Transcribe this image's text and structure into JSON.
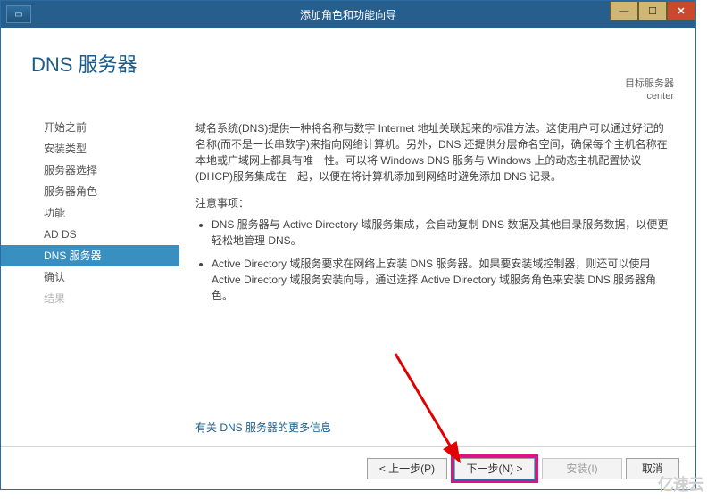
{
  "titlebar": {
    "title": "添加角色和功能向导"
  },
  "heading": "DNS 服务器",
  "target": {
    "label": "目标服务器",
    "name": "center"
  },
  "sidebar": {
    "items": [
      {
        "label": "开始之前",
        "state": "enabled"
      },
      {
        "label": "安装类型",
        "state": "enabled"
      },
      {
        "label": "服务器选择",
        "state": "enabled"
      },
      {
        "label": "服务器角色",
        "state": "enabled"
      },
      {
        "label": "功能",
        "state": "enabled"
      },
      {
        "label": "AD DS",
        "state": "enabled"
      },
      {
        "label": "DNS 服务器",
        "state": "active"
      },
      {
        "label": "确认",
        "state": "enabled"
      },
      {
        "label": "结果",
        "state": "disabled"
      }
    ]
  },
  "main": {
    "para1": "域名系统(DNS)提供一种将名称与数字 Internet 地址关联起来的标准方法。这使用户可以通过好记的名称(而不是一长串数字)来指向网络计算机。另外，DNS 还提供分层命名空间，确保每个主机名称在本地或广域网上都具有唯一性。可以将 Windows DNS 服务与 Windows 上的动态主机配置协议(DHCP)服务集成在一起，以便在将计算机添加到网络时避免添加 DNS 记录。",
    "note_label": "注意事项：",
    "bullets": [
      "DNS 服务器与 Active Directory 域服务集成，会自动复制 DNS 数据及其他目录服务数据，以便更轻松地管理 DNS。",
      "Active Directory 域服务要求在网络上安装 DNS 服务器。如果要安装域控制器，则还可以使用 Active Directory 域服务安装向导，通过选择 Active Directory 域服务角色来安装 DNS 服务器角色。"
    ],
    "more_link": "有关 DNS 服务器的更多信息"
  },
  "footer": {
    "prev": "< 上一步(P)",
    "next": "下一步(N) >",
    "install": "安装(I)",
    "cancel": "取消"
  },
  "watermark": "亿速云"
}
